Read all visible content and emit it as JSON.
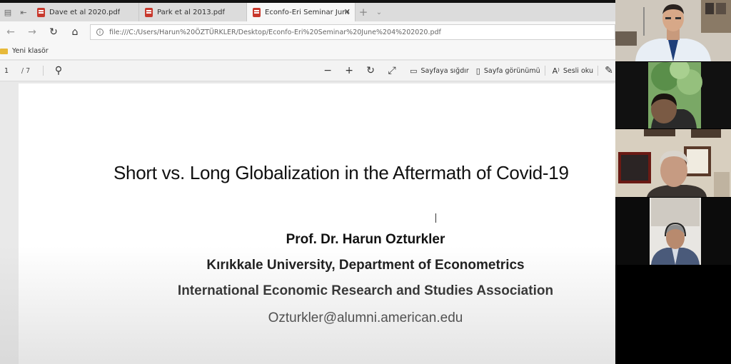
{
  "tabs": [
    {
      "title": "Dave et al 2020.pdf",
      "active": false
    },
    {
      "title": "Park et al 2013.pdf",
      "active": false
    },
    {
      "title": "Econfo-Eri Seminar June",
      "active": true
    }
  ],
  "tab_close_glyph": "✕",
  "new_tab_glyph": "+",
  "address": {
    "url": "file:///C:/Users/Harun%20ÖZTÜRKLER/Desktop/Econfo-Eri%20Seminar%20June%204%202020.pdf"
  },
  "favorites": [
    {
      "label": "Yeni klasör",
      "icon": "folder-icon"
    }
  ],
  "pdf_toolbar": {
    "page": "1",
    "total": "/ 7",
    "fit_page_label": "Sayfaya sığdır",
    "page_view_label": "Sayfa görünümü",
    "read_aloud_label": "Sesli oku"
  },
  "slide": {
    "title": "Short vs. Long Globalization in the Aftermath of Covid-19",
    "author": "Prof. Dr. Harun Ozturkler",
    "affiliation": "Kırıkkale University, Department of Econometrics",
    "association": "International Economic Research and Studies Association",
    "email": "Ozturkler@alumni.american.edu"
  },
  "colors": {
    "pdf_icon": "#c8382c",
    "folder_icon": "#e7b93a",
    "video_background": "#000000"
  }
}
